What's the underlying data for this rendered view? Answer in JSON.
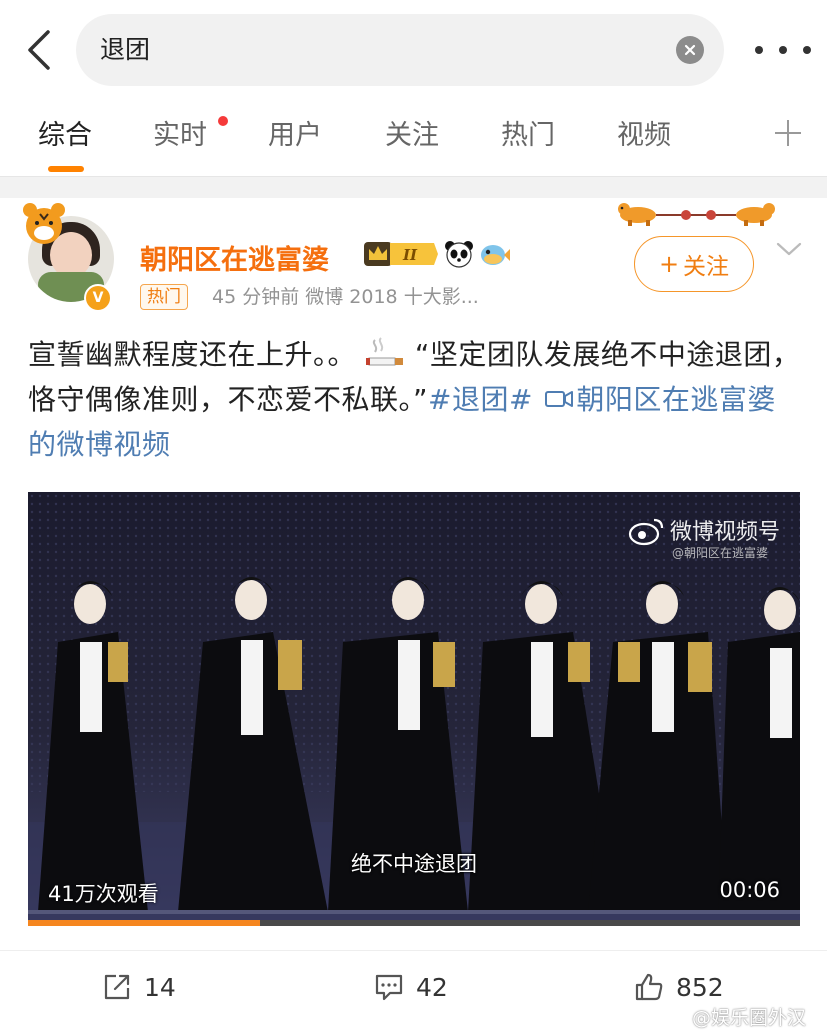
{
  "search": {
    "query": "退团"
  },
  "tabs": [
    {
      "label": "综合",
      "active": true
    },
    {
      "label": "实时",
      "has_dot": true
    },
    {
      "label": "用户"
    },
    {
      "label": "关注"
    },
    {
      "label": "热门"
    },
    {
      "label": "视频"
    }
  ],
  "post": {
    "username": "朝阳区在逃富婆",
    "badge_level": "II",
    "tag": "热门",
    "meta": "45 分钟前  微博 2018 十大影...",
    "follow_label": "关注",
    "text_part1": "宣誓幽默程度还在上升。。",
    "text_part2": "“坚定团队发展绝不中途退团，恪守偶像准则，不恋爱不私联。”",
    "hashtag": "#退团#",
    "video_link": "朝阳区在逃富婆的微博视频",
    "video": {
      "watermark_title": "微博视频号",
      "watermark_sub": "@朝阳区在逃富婆",
      "subtitle": "绝不中途退团",
      "views": "41万次观看",
      "duration": "00:06",
      "progress": 0.3
    },
    "actions": {
      "reposts": "14",
      "comments": "42",
      "likes": "852"
    },
    "site_watermark": "@娱乐圈外汉"
  },
  "colors": {
    "accent": "#ff8200",
    "username": "#f56f0e",
    "link": "#4f7db2",
    "badge": "#f5a11a"
  },
  "icons": [
    "back-arrow-icon",
    "clear-icon",
    "more-icon",
    "add-tab-icon",
    "verified-icon",
    "crown-badge-icon",
    "panda-icon",
    "pufferfish-icon",
    "dog-decoration-icon",
    "chevron-down-icon",
    "cigarette-emoji-icon",
    "video-camera-icon",
    "weibo-logo-icon",
    "repost-icon",
    "comment-icon",
    "like-icon"
  ]
}
